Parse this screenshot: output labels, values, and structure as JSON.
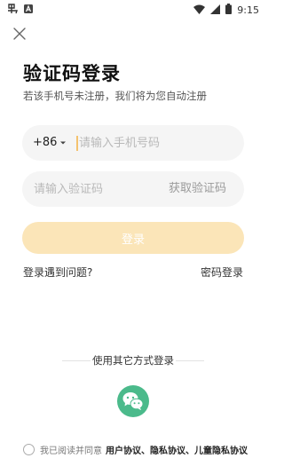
{
  "status_bar": {
    "time": "9:15",
    "left_icons": [
      "app-notification-icon",
      "text-notification-icon"
    ],
    "right_icons": [
      "wifi-icon",
      "cell-signal-icon",
      "battery-icon"
    ]
  },
  "header": {
    "close_icon": "close-icon",
    "title": "验证码登录",
    "subtitle": "若该手机号未注册，我们将为您自动注册"
  },
  "phone_field": {
    "country_code": "+86",
    "placeholder": "请输入手机号码",
    "value": ""
  },
  "code_field": {
    "placeholder": "请输入验证码",
    "value": "",
    "get_code_label": "获取验证码"
  },
  "login_button": {
    "label": "登录",
    "enabled": false
  },
  "links": {
    "problem": "登录遇到问题?",
    "password_login": "密码登录"
  },
  "other_login": {
    "label": "使用其它方式登录",
    "methods": [
      {
        "name": "wechat",
        "icon": "wechat-icon"
      }
    ]
  },
  "agreement": {
    "checked": false,
    "prefix": "我已阅读并同意",
    "links": "用户协议、隐私协议、儿童隐私协议"
  },
  "colors": {
    "accent": "#f4c26e",
    "login_disabled_bg": "#fbe5b8",
    "field_bg": "#f5f5f5",
    "wechat_green": "#4bba8b"
  }
}
